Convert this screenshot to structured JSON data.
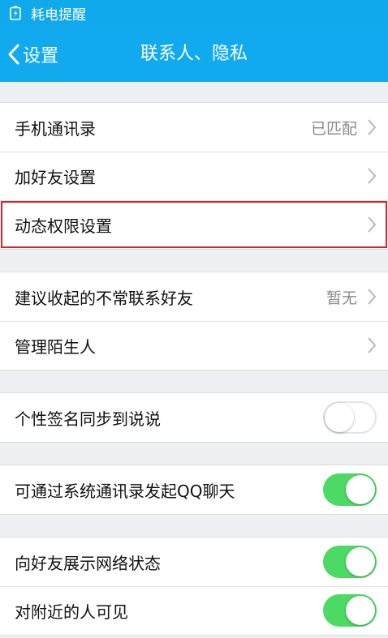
{
  "status_bar": {
    "text": "耗电提醒",
    "icon": "battery-alert-icon"
  },
  "nav": {
    "back_label": "设置",
    "title": "联系人、隐私"
  },
  "groups": [
    {
      "rows": [
        {
          "label": "手机通讯录",
          "value": "已匹配",
          "type": "link"
        },
        {
          "label": "加好友设置",
          "type": "link"
        },
        {
          "label": "动态权限设置",
          "type": "link",
          "highlighted": true
        }
      ]
    },
    {
      "rows": [
        {
          "label": "建议收起的不常联系好友",
          "value": "暂无",
          "type": "link"
        },
        {
          "label": "管理陌生人",
          "type": "link"
        }
      ]
    },
    {
      "rows": [
        {
          "label": "个性签名同步到说说",
          "type": "toggle",
          "on": false
        }
      ]
    },
    {
      "rows": [
        {
          "label": "可通过系统通讯录发起QQ聊天",
          "type": "toggle",
          "on": true
        }
      ]
    },
    {
      "rows": [
        {
          "label": "向好友展示网络状态",
          "type": "toggle",
          "on": true
        },
        {
          "label": "对附近的人可见",
          "type": "toggle",
          "on": true
        }
      ]
    }
  ],
  "colors": {
    "header": "#12aaee",
    "toggle_on": "#4cd964",
    "highlight": "#d4232a",
    "background": "#eef0f3"
  }
}
